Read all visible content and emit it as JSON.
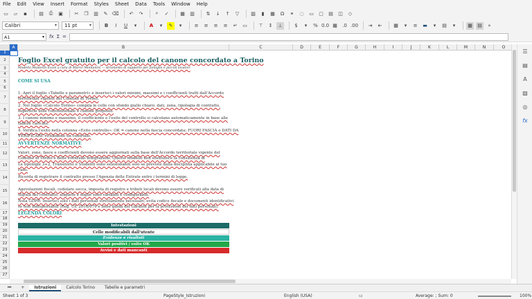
{
  "menu": [
    "File",
    "Edit",
    "View",
    "Insert",
    "Format",
    "Styles",
    "Sheet",
    "Data",
    "Tools",
    "Window",
    "Help"
  ],
  "toolbar": {
    "font_name": "Calibri",
    "font_size": "11 pt",
    "bold": "B",
    "italic": "I",
    "underline": "U",
    "currency": "$",
    "percent": "%",
    "decimal": "0.0",
    "number_format": ".00",
    "add_decimal": ".0"
  },
  "formula": {
    "cell_ref": "A1",
    "fx": "fx",
    "sigma": "Σ",
    "equals": "="
  },
  "columns": [
    "A",
    "B",
    "C",
    "D",
    "E",
    "F",
    "G",
    "H",
    "I",
    "J",
    "K",
    "L",
    "M",
    "N",
    "O"
  ],
  "rows": [
    "1",
    "2",
    "3",
    "4",
    "5",
    "6",
    "7",
    "8",
    "9",
    "10",
    "11",
    "12",
    "13",
    "14",
    "15",
    "16",
    "17",
    "18",
    "19",
    "20",
    "21",
    "22",
    "23",
    "24",
    "25",
    "26",
    "27"
  ],
  "content": {
    "title": "Foglio Excel gratuito per il calcolo del canone concordato a Torino",
    "subtitle": "Modello Masterfo Excel a cura di Marco Montanini — strumento di supporto per famiglie e piccoli locatori",
    "heading_how": "COME SI USA",
    "step1a": "1. Apri il foglio «Tabelle e parametri» e inserisci i valori minimi, massimi e i coefficienti tratti dall'Accordo",
    "step1b": "territoriale vigente del Comune di Torino.",
    "step2a": "2. Nel foglio «Calcolo Torino» compila le celle con sfondo giallo chiaro: dati, zona, tipologia di contratto,",
    "step2b": "superficie utile convenzionale e canone proposto.",
    "step3a": "3. I canoni minimo e massimo, il coefficiente e l'esito del controllo si calcolano automaticamente in base alle",
    "step3b": "tabelle caricate.",
    "step4a": "4. Verifica l'esito nella colonna «Esito controllo»: OK = canone nella fascia concordata; FUORI FASCIA o DATI DA",
    "step4b": "VERIFICARE richiedono un controllo.",
    "heading_warn": "AVVERTENZE NORMATIVE",
    "warn1a": "Valori, zone, fasce e coefficienti devono essere aggiornati sulla base dell'Accordo territoriale vigente del",
    "warn1b": "Comune di Torino e delle eventuali integrazioni. Questo modello non sostituisce la consulenza di",
    "warn2a": "Le tipologie 3+2, Transitorio e Studenti sono selezionabili solo se previste dalla disciplina applicabile al tuo",
    "warn2b": "caso.",
    "warn3": "Ricorda di registrare il contratto presso l'Agenzia delle Entrate entro i termini di legge.",
    "warn4a": "Agevolazioni fiscali, cedolare secca, imposta di registro e tributi locali devono essere verificati alla data di",
    "warn4b": "stipula del contratto: aliquote e soglie sono variabili e configurabili.",
    "warn5a": "Nota GDPR: inserisci solo i dati personali strettamente necessari; evita codice fiscale e documenti identificativi",
    "warn5b": "se non indispensabili (Reg. UE 2016/679 e linee guida del Garante per la protezione dei dati personali).",
    "heading_legend": "LEGENDA COLORI",
    "legend": [
      {
        "label": "Intestazioni",
        "bg": "#1b6b67",
        "fg": "#ffffff"
      },
      {
        "label": "Celle modificabili dall'utente",
        "bg": "#ffffff",
        "fg": "#222222"
      },
      {
        "label": "Evidenze e risultati",
        "bg": "#2bb3a3",
        "fg": "#ffffff"
      },
      {
        "label": "Valori positivi / esito OK",
        "bg": "#22a84a",
        "fg": "#ffffff"
      },
      {
        "label": "Avvisi e dati mancanti",
        "bg": "#d62b2b",
        "fg": "#ffffff"
      }
    ]
  },
  "tabs": [
    "Istruzioni",
    "Calcolo Torino",
    "Tabelle e parametri"
  ],
  "active_tab": "Istruzioni",
  "status": {
    "sheet": "Sheet 1 of 3",
    "style": "PageStyle_Istruzioni",
    "language": "English (USA)",
    "stats": "Average: ; Sum: 0",
    "zoom": "100%"
  },
  "colors": {
    "accent": "#1f9a9a",
    "title": "#1b5f63"
  }
}
